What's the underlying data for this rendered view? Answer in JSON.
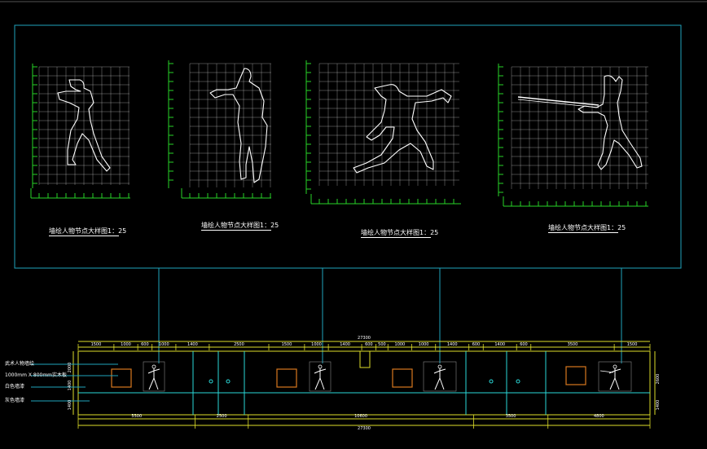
{
  "detail_captions": [
    "墙绘人物节点大样图1：25",
    "墙绘人物节点大样图1：25",
    "墙绘人物节点大样图1：25",
    "墙绘人物节点大样图1：25"
  ],
  "legend_labels": [
    "武术人物墙绘",
    "1000mm X 800mm实木板",
    "白色墙漆",
    "灰色墙漆"
  ],
  "top_dims": {
    "overall": "27300",
    "segments": [
      "1500",
      "1000",
      "600",
      "1000",
      "1400",
      "2500",
      "1500",
      "1000",
      "1400",
      "600",
      "500",
      "1000",
      "1000",
      "1400",
      "600",
      "1400",
      "600",
      "3500",
      "1500"
    ]
  },
  "bottom_dims": {
    "overall": "27300",
    "segments": [
      "5500",
      "2500",
      "10600",
      "3500",
      "4800"
    ]
  },
  "side_dims": {
    "left": [
      "2000",
      "1400",
      "1400"
    ],
    "right": [
      "2600",
      "1400"
    ]
  },
  "colors": {
    "frame": "#1fa3bd",
    "grid": "#d9d9d9",
    "green": "#27d427",
    "yellow": "#dede2a",
    "cyan": "#2ad8d8",
    "orange": "#d9781e",
    "white": "#ffffff"
  }
}
